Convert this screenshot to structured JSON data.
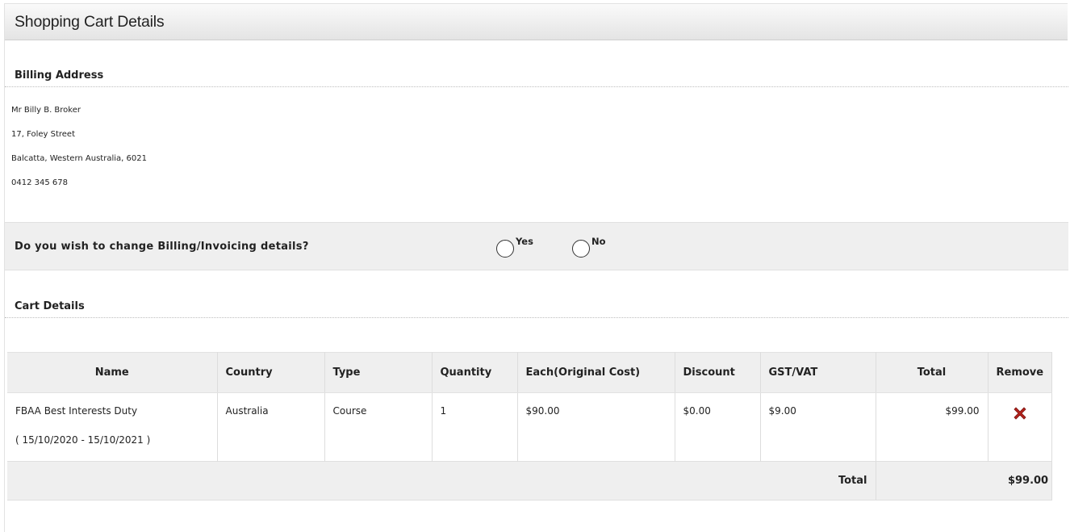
{
  "header": {
    "title": "Shopping Cart Details"
  },
  "billing": {
    "title": "Billing Address",
    "lines": [
      "Mr Billy B. Broker",
      "17, Foley Street",
      "Balcatta, Western Australia, 6021",
      "0412 345 678"
    ]
  },
  "change_billing": {
    "question": "Do you wish to change Billing/Invoicing details?",
    "yes_label": "Yes",
    "no_label": "No"
  },
  "cart": {
    "title": "Cart Details",
    "columns": [
      "Name",
      "Country",
      "Type",
      "Quantity",
      "Each(Original Cost)",
      "Discount",
      "GST/VAT",
      "Total",
      "Remove"
    ],
    "rows": [
      {
        "name": "FBAA Best Interests Duty",
        "period": "( 15/10/2020 - 15/10/2021 )",
        "country": "Australia",
        "type": "Course",
        "quantity": "1",
        "each": "$90.00",
        "discount": "$0.00",
        "gst": "$9.00",
        "total": "$99.00",
        "remove_icon": "close-x-icon"
      }
    ],
    "total_label": "Total",
    "total_value": "$99.00"
  },
  "colors": {
    "remove_icon": "#b3221c",
    "bar_background": "#efefef"
  }
}
